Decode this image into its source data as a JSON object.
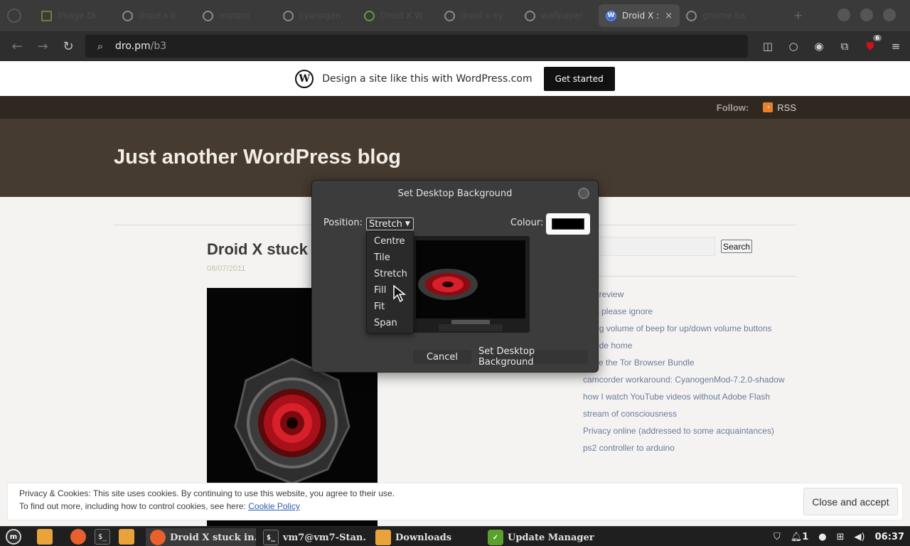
{
  "browser": {
    "tabs": [
      {
        "label": "Image Di"
      },
      {
        "label": "droid x b"
      },
      {
        "label": "motoro"
      },
      {
        "label": "cyanogen"
      },
      {
        "label": "Droid X W"
      },
      {
        "label": "droid x ey"
      },
      {
        "label": "wallpaper"
      },
      {
        "label": "Droid X :",
        "active": true
      },
      {
        "label": "gnome ba"
      }
    ],
    "active_tab_close": "×",
    "url_host": "dro.pm",
    "url_path": "/b3",
    "extension_badge": "6"
  },
  "wp_banner": {
    "logo_letter": "W",
    "text": "Design a site like this with WordPress.com",
    "button": "Get started"
  },
  "site": {
    "follow_label": "Follow:",
    "rss_label": "RSS",
    "title": "Just another WordPress blog",
    "post_title": "Droid X stuck",
    "post_date": "08/07/2011",
    "search_button": "Search",
    "recent_posts": [
      "2 in review",
      "post please ignore",
      "nging volume of beep for up/down volume buttons",
      "ke ride home",
      "I love the Tor Browser Bundle",
      "camcorder workaround: CyanogenMod-7.2.0-shadow",
      "how I watch YouTube videos without Adobe Flash",
      "stream of consciousness",
      "Privacy online (addressed to some acquaintances)",
      "ps2 controller to arduino"
    ]
  },
  "cookie": {
    "line1": "Privacy & Cookies: This site uses cookies. By continuing to use this website, you agree to their use.",
    "line2_prefix": "To find out more, including how to control cookies, see here: ",
    "link": "Cookie Policy",
    "button": "Close and accept"
  },
  "dialog": {
    "title": "Set Desktop Background",
    "position_label": "Position:",
    "position_value": "Stretch",
    "colour_label": "Colour:",
    "colour_value": "#000000",
    "options": [
      "Centre",
      "Tile",
      "Stretch",
      "Fill",
      "Fit",
      "Span"
    ],
    "cancel": "Cancel",
    "apply": "Set Desktop Background"
  },
  "taskbar": {
    "tasks": [
      {
        "label": "Droid X stuck in...",
        "active": true
      },
      {
        "label": "vm7@vm7-Stan..."
      },
      {
        "label": "Downloads"
      },
      {
        "label": "Update Manager"
      }
    ],
    "notif_count": "1",
    "clock": "06:37"
  },
  "colors": {
    "header_bg": "#463b30",
    "follow_bg": "#2e2820",
    "link": "#6a7c9a",
    "accent_red": "#d1101a"
  }
}
